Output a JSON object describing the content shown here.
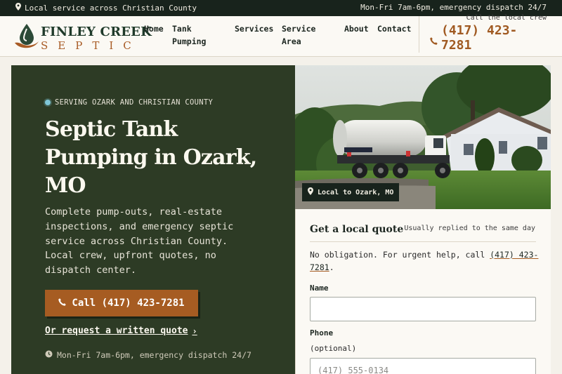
{
  "topbar": {
    "location": "Local service across Christian County",
    "hours": "Mon-Fri 7am-6pm, emergency dispatch 24/7"
  },
  "brand": {
    "name_top": "FINLEY CREEK",
    "name_bottom": "SEPTIC"
  },
  "nav": {
    "links": [
      "Home",
      "Tank Pumping",
      "Services",
      "Service Area",
      "About",
      "Contact"
    ],
    "call_label": "Call the local crew",
    "phone": "(417) 423-7281"
  },
  "hero": {
    "eyebrow": "SERVING OZARK AND CHRISTIAN COUNTY",
    "title": "Septic Tank Pumping in Ozark, MO",
    "lead": "Complete pump-outs, real-estate inspections, and emergency septic service across Christian County. Local crew, upfront quotes, no dispatch center.",
    "cta": "Call (417) 423-7281",
    "secondary_link": "Or request a written quote",
    "hours_note": "Mon-Fri 7am-6pm, emergency dispatch 24/7"
  },
  "photo": {
    "badge": "Local to Ozark, MO"
  },
  "form": {
    "title": "Get a local quote",
    "subtitle": "Usually replied to the same day",
    "note_prefix": "No obligation. For urgent help, call ",
    "note_phone": "(417) 423-7281",
    "note_suffix": ".",
    "name_label": "Name",
    "name_value": "",
    "phone_label": "Phone",
    "phone_optional": "(optional)",
    "phone_placeholder": "(417) 555-0134",
    "phone_value": ""
  },
  "colors": {
    "topbar_bg": "#18231c",
    "hero_bg": "#2d3b25",
    "accent": "#a65c22",
    "page_bg": "#f4f1ea"
  },
  "icons": [
    "map-pin-icon",
    "droplet-logo-icon",
    "phone-icon",
    "clock-icon",
    "chevron-right-icon"
  ]
}
